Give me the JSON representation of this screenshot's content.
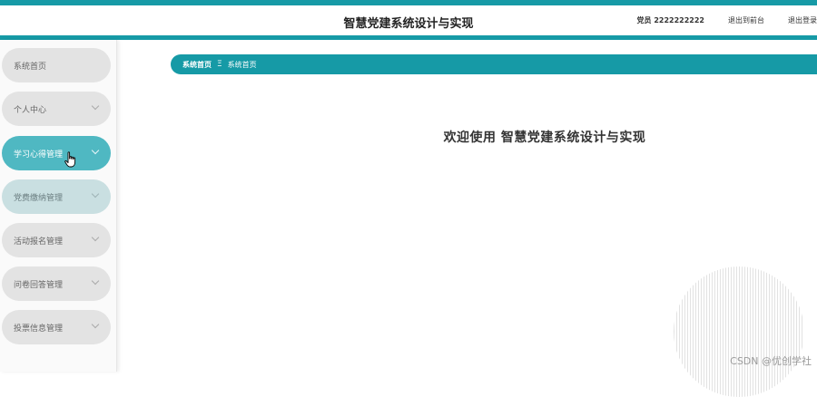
{
  "header": {
    "app_title": "智慧党建系统设计与实现",
    "user_info": "党员 2222222222",
    "frontend_link": "退出到前台",
    "logout_link": "退出登录"
  },
  "sidebar": {
    "items": [
      {
        "label": "系统首页",
        "has_submenu": false,
        "state": "normal"
      },
      {
        "label": "个人中心",
        "has_submenu": true,
        "state": "normal"
      },
      {
        "label": "学习心得管理",
        "has_submenu": true,
        "state": "active"
      },
      {
        "label": "党费缴纳管理",
        "has_submenu": true,
        "state": "hover"
      },
      {
        "label": "活动报名管理",
        "has_submenu": true,
        "state": "normal"
      },
      {
        "label": "问卷回答管理",
        "has_submenu": true,
        "state": "normal"
      },
      {
        "label": "投票信息管理",
        "has_submenu": true,
        "state": "normal"
      }
    ]
  },
  "breadcrumb": {
    "home": "系统首页",
    "separator": "Ξ",
    "current": "系统首页"
  },
  "main": {
    "welcome_text": "欢迎使用 智慧党建系统设计与实现"
  },
  "watermark": "CSDN @优创学社",
  "colors": {
    "accent": "#169aa6",
    "menu_active": "#4fb8c2",
    "menu_hover": "#c9dfe1",
    "menu_default": "#e3e3e3"
  }
}
